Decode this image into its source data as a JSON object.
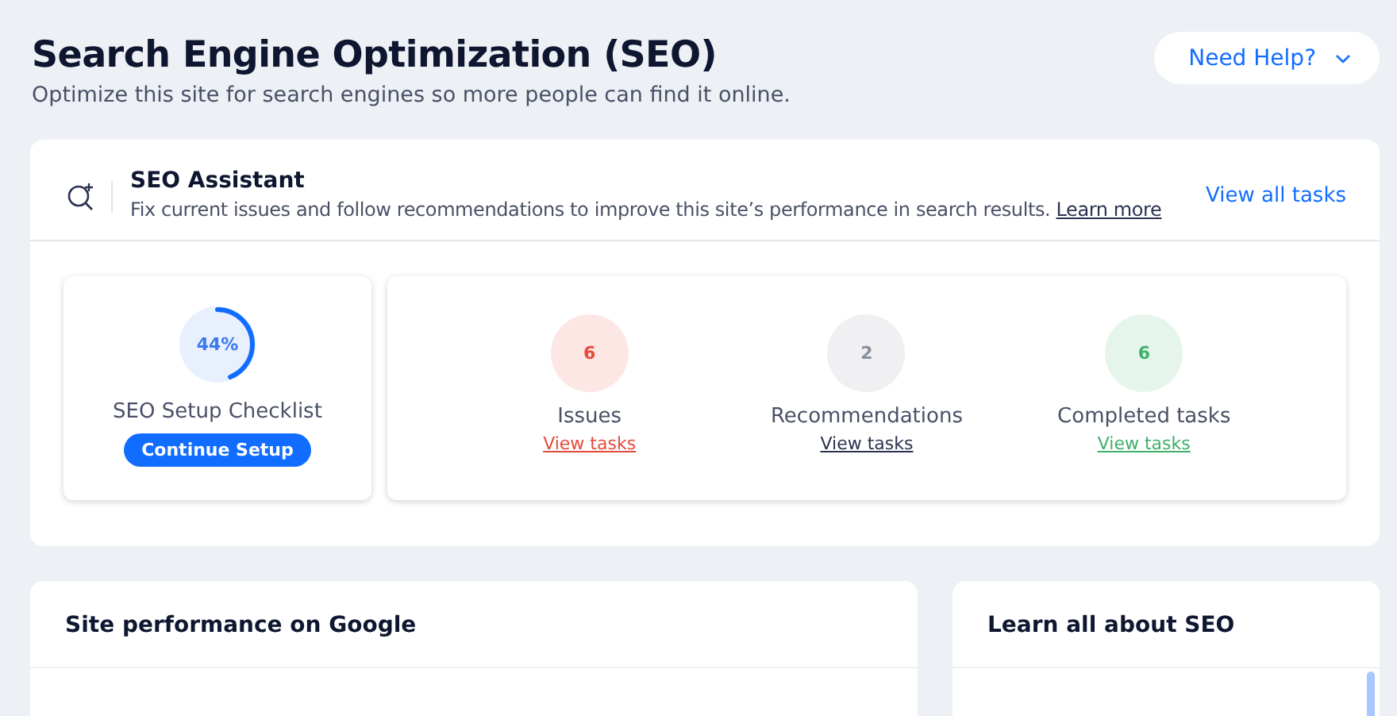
{
  "header": {
    "title": "Search Engine Optimization (SEO)",
    "subtitle": "Optimize this site for search engines so more people can find it online.",
    "help_button": "Need Help?"
  },
  "assistant": {
    "title": "SEO Assistant",
    "description": "Fix current issues and follow recommendations to improve this site’s performance in search results.",
    "learn_more": "Learn more",
    "view_all": "View all tasks",
    "checklist": {
      "percent": "44%",
      "level": 0.44,
      "label": "SEO Setup Checklist",
      "button": "Continue Setup"
    },
    "stats": [
      {
        "count": "6",
        "label": "Issues",
        "link": "View tasks",
        "color": "#e5493a"
      },
      {
        "count": "2",
        "label": "Recommendations",
        "link": "View tasks",
        "color": "#8a8f9e"
      },
      {
        "count": "6",
        "label": "Completed tasks",
        "link": "View tasks",
        "color": "#3fb06a"
      }
    ]
  },
  "panels": [
    {
      "title": "Site performance on Google"
    },
    {
      "title": "Learn all about SEO"
    }
  ]
}
